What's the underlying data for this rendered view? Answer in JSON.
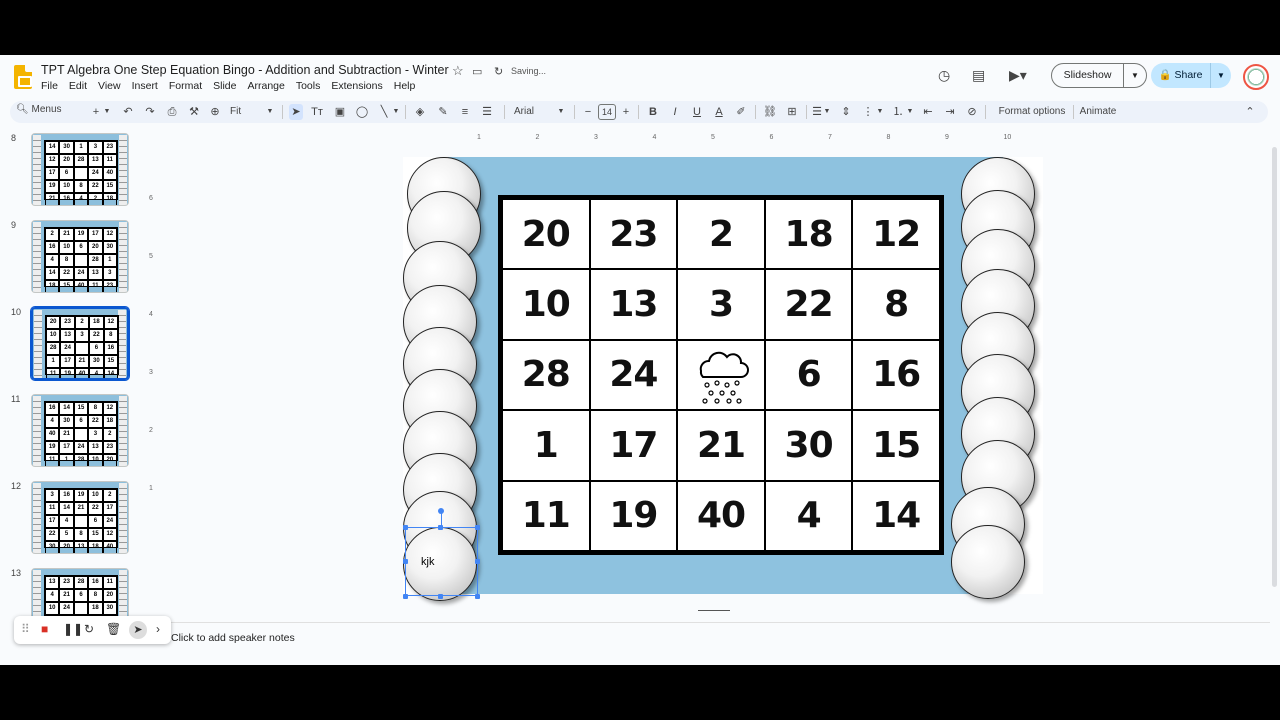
{
  "document": {
    "title": "TPT Algebra One Step Equation Bingo - Addition and Subtraction - Winter",
    "status": "Saving..."
  },
  "menu": [
    "File",
    "Edit",
    "View",
    "Insert",
    "Format",
    "Slide",
    "Arrange",
    "Tools",
    "Extensions",
    "Help"
  ],
  "header": {
    "slideshow_label": "Slideshow",
    "share_label": "Share"
  },
  "toolbar": {
    "menus_label": "Menus",
    "zoom": "Fit",
    "font": "Arial",
    "font_size": "14",
    "format_options": "Format options",
    "animate": "Animate"
  },
  "ruler": {
    "h_ticks": [
      "1",
      "2",
      "3",
      "4",
      "5",
      "6",
      "7",
      "8",
      "9",
      "10"
    ],
    "v_ticks": [
      "6",
      "5",
      "4",
      "3",
      "2",
      "1"
    ]
  },
  "filmstrip": [
    {
      "num": "8",
      "cells": [
        "14",
        "30",
        "1",
        "3",
        "23",
        "12",
        "20",
        "28",
        "13",
        "11",
        "17",
        "6",
        "",
        "24",
        "40",
        "19",
        "10",
        "8",
        "22",
        "15",
        "21",
        "16",
        "4",
        "2",
        "18"
      ],
      "selected": false
    },
    {
      "num": "9",
      "cells": [
        "2",
        "21",
        "19",
        "17",
        "12",
        "16",
        "10",
        "6",
        "20",
        "30",
        "4",
        "8",
        "",
        "28",
        "1",
        "14",
        "22",
        "24",
        "13",
        "3",
        "18",
        "15",
        "40",
        "11",
        "23"
      ],
      "selected": false
    },
    {
      "num": "10",
      "cells": [
        "20",
        "23",
        "2",
        "18",
        "12",
        "10",
        "13",
        "3",
        "22",
        "8",
        "28",
        "24",
        "",
        "6",
        "16",
        "1",
        "17",
        "21",
        "30",
        "15",
        "11",
        "19",
        "40",
        "4",
        "14"
      ],
      "selected": true
    },
    {
      "num": "11",
      "cells": [
        "16",
        "14",
        "15",
        "8",
        "12",
        "4",
        "30",
        "6",
        "22",
        "18",
        "40",
        "21",
        "",
        "3",
        "2",
        "19",
        "17",
        "24",
        "13",
        "23",
        "11",
        "1",
        "28",
        "10",
        "20"
      ],
      "selected": false
    },
    {
      "num": "12",
      "cells": [
        "3",
        "16",
        "19",
        "10",
        "2",
        "11",
        "14",
        "21",
        "22",
        "17",
        "17",
        "4",
        "",
        "6",
        "24",
        "22",
        "5",
        "8",
        "15",
        "12",
        "30",
        "20",
        "13",
        "18",
        "40"
      ],
      "selected": false
    },
    {
      "num": "13",
      "cells": [
        "13",
        "23",
        "28",
        "16",
        "11",
        "4",
        "21",
        "6",
        "8",
        "20",
        "10",
        "24",
        "",
        "18",
        "30",
        "",
        "",
        "",
        "",
        ""
      ],
      "selected": false
    }
  ],
  "slide": {
    "board": [
      "20",
      "23",
      "2",
      "18",
      "12",
      "10",
      "13",
      "3",
      "22",
      "8",
      "28",
      "24",
      "",
      "6",
      "16",
      "1",
      "17",
      "21",
      "30",
      "15",
      "11",
      "19",
      "40",
      "4",
      "14"
    ],
    "free_space_icon": "snow-cloud-icon",
    "textbox_text": "kjk"
  },
  "notes": {
    "placeholder": "Click to add speaker notes"
  },
  "colors": {
    "slide_background": "#8ec2df",
    "share_button": "#c2e7ff",
    "selection": "#4285f4",
    "logo": "#f4b400"
  }
}
